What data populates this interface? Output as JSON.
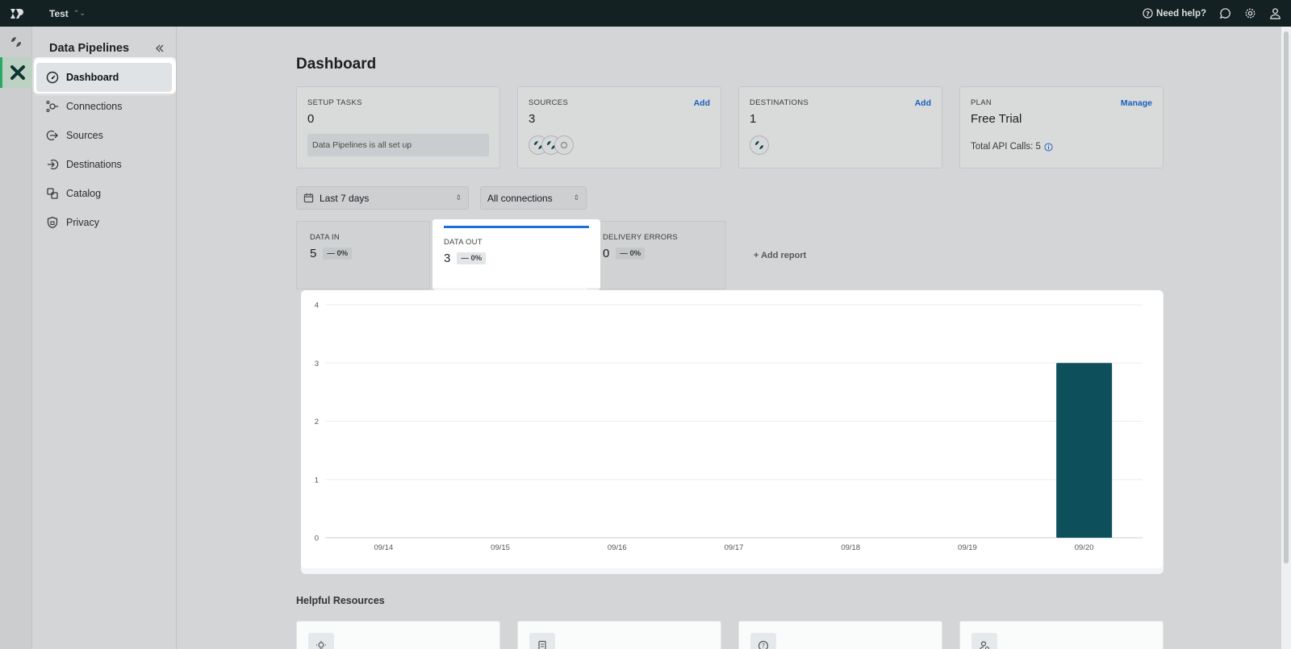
{
  "topbar": {
    "workspace": "Test",
    "help_label": "Need help?"
  },
  "sidebar": {
    "title": "Data Pipelines",
    "items": [
      {
        "label": "Dashboard",
        "icon": "gauge-icon"
      },
      {
        "label": "Connections",
        "icon": "connections-icon"
      },
      {
        "label": "Sources",
        "icon": "sources-icon"
      },
      {
        "label": "Destinations",
        "icon": "destinations-icon"
      },
      {
        "label": "Catalog",
        "icon": "catalog-icon"
      },
      {
        "label": "Privacy",
        "icon": "privacy-icon"
      }
    ]
  },
  "page": {
    "title": "Dashboard"
  },
  "cards": {
    "setup": {
      "label": "SETUP TASKS",
      "value": "0",
      "note": "Data Pipelines is all set up"
    },
    "sources": {
      "label": "SOURCES",
      "value": "3",
      "link": "Add"
    },
    "destinations": {
      "label": "DESTINATIONS",
      "value": "1",
      "link": "Add"
    },
    "plan": {
      "label": "PLAN",
      "value": "Free Trial",
      "link": "Manage",
      "api_calls": "Total API Calls: 5"
    }
  },
  "filters": {
    "range": "Last 7 days",
    "connections": "All connections"
  },
  "metrics": [
    {
      "label": "DATA IN",
      "value": "5",
      "change": "— 0%"
    },
    {
      "label": "DATA OUT",
      "value": "3",
      "change": "— 0%"
    },
    {
      "label": "DELIVERY ERRORS",
      "value": "0",
      "change": "— 0%"
    }
  ],
  "add_report": "+ Add report",
  "chart_data": {
    "type": "bar",
    "categories": [
      "09/14",
      "09/15",
      "09/16",
      "09/17",
      "09/18",
      "09/19",
      "09/20"
    ],
    "values": [
      0,
      0,
      0,
      0,
      0,
      0,
      3
    ],
    "yticks": [
      "0",
      "1",
      "2",
      "3",
      "4"
    ],
    "ylim": [
      0,
      4
    ],
    "grid": true,
    "bar_color": "#0d4f5b"
  },
  "helpful": {
    "title": "Helpful Resources"
  },
  "colors": {
    "accent": "#1c6fd8",
    "topbar": "#162628",
    "brand_green": "#32c274"
  }
}
